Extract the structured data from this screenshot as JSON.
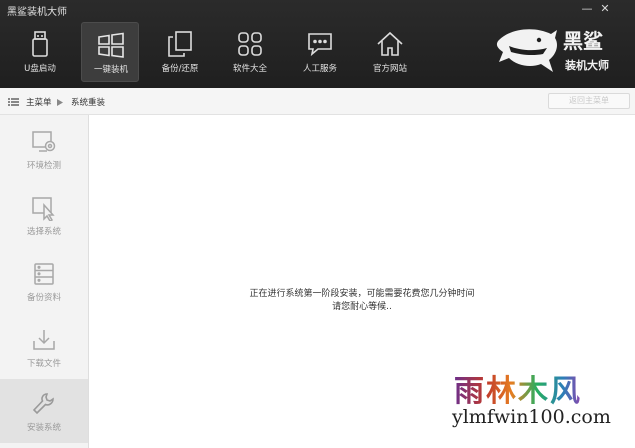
{
  "window": {
    "title": "黑鲨装机大师",
    "minimize": "—",
    "close": "✕"
  },
  "nav": [
    {
      "label": "U盘启动",
      "icon": "usb-drive-icon"
    },
    {
      "label": "一键装机",
      "icon": "windows-icon",
      "active": true
    },
    {
      "label": "备份/还原",
      "icon": "backup-restore-icon"
    },
    {
      "label": "软件大全",
      "icon": "apps-grid-icon"
    },
    {
      "label": "人工服务",
      "icon": "chat-bubble-icon"
    },
    {
      "label": "官方网站",
      "icon": "home-icon"
    }
  ],
  "logo": {
    "text_line1": "黑鲨",
    "text_line2": "装机大师"
  },
  "breadcrumb": {
    "root": "主菜单",
    "current": "系统重装",
    "back": "返回主菜单"
  },
  "steps": [
    {
      "label": "环境检测",
      "icon": "environment-check-icon"
    },
    {
      "label": "选择系统",
      "icon": "select-system-icon"
    },
    {
      "label": "备份资料",
      "icon": "backup-data-icon"
    },
    {
      "label": "下载文件",
      "icon": "download-icon"
    },
    {
      "label": "安装系统",
      "icon": "install-wrench-icon",
      "active": true
    }
  ],
  "main": {
    "message_line1": "正在进行系统第一阶段安装，可能需要花费您几分钟时间",
    "message_line2": "请您耐心等候.."
  },
  "watermark": {
    "chinese": "雨林木风",
    "url": "ylmfwin100.com"
  },
  "colors": {
    "header_bg": "#222222",
    "sidebar_bg": "#f3f3f3",
    "active_step_bg": "#e2e2e2"
  }
}
